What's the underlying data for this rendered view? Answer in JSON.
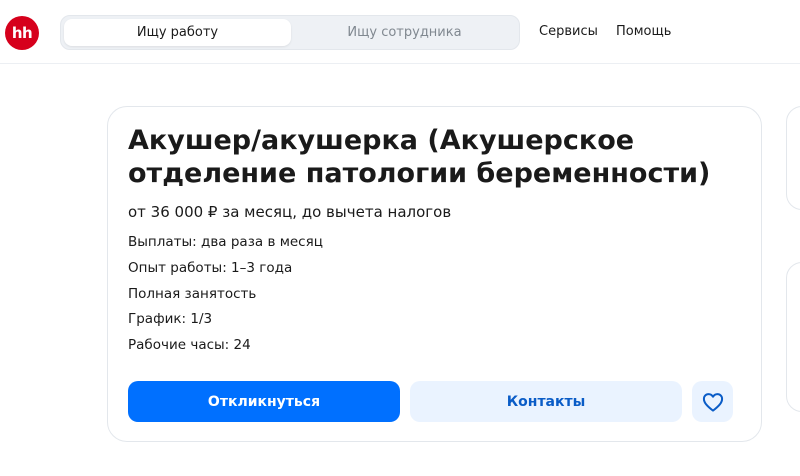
{
  "header": {
    "logo_text": "hh",
    "tabs": [
      {
        "label": "Ищу работу",
        "active": true
      },
      {
        "label": "Ищу сотрудника",
        "active": false
      }
    ],
    "nav": [
      "Сервисы",
      "Помощь"
    ]
  },
  "vacancy": {
    "title": "Акушер/акушерка (Акушерское отделение патологии беременности)",
    "salary": "от 36 000 ₽ за месяц, до вычета налогов",
    "details": [
      "Выплаты: два раза в месяц",
      "Опыт работы: 1–3 года",
      "Полная занятость",
      "График: 1/3",
      "Рабочие часы: 24"
    ],
    "respond_label": "Откликнуться",
    "contacts_label": "Контакты",
    "favorite_icon": "heart-icon"
  },
  "colors": {
    "brand": "#d6001c",
    "primary_button": "#0070ff",
    "secondary_button": "#eaf3ff"
  }
}
